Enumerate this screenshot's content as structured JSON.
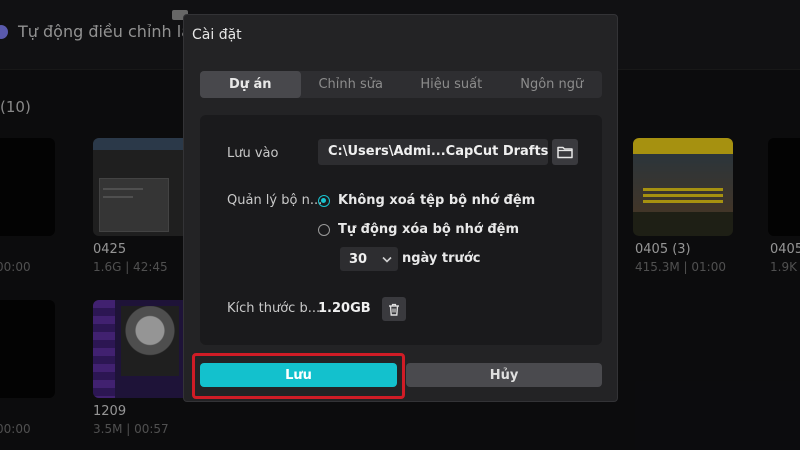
{
  "background": {
    "auto_adjust_label": "Tự động điều chỉnh lại",
    "project_count": "(10)",
    "projects": [
      {
        "title": "",
        "meta": "00:00"
      },
      {
        "title": "0425",
        "meta": "1.6G | 42:45"
      },
      {
        "title": "0405 (3)",
        "meta": "415.3M | 01:00"
      },
      {
        "title": "0405",
        "meta": "1.9K"
      },
      {
        "title": "",
        "meta": "00:00"
      },
      {
        "title": "1209",
        "meta": "3.5M | 00:57"
      }
    ]
  },
  "modal": {
    "title": "Cài đặt",
    "tabs": [
      {
        "label": "Dự án",
        "active": true
      },
      {
        "label": "Chỉnh sửa",
        "active": false
      },
      {
        "label": "Hiệu suất",
        "active": false
      },
      {
        "label": "Ngôn ngữ",
        "active": false
      }
    ],
    "save_location": {
      "label": "Lưu vào",
      "value": "C:\\Users\\Admi...CapCut Drafts",
      "icon": "folder-icon"
    },
    "cache": {
      "label": "Quản lý bộ n...",
      "options": [
        {
          "label": "Không xoá tệp bộ nhớ đệm",
          "selected": true
        },
        {
          "label": "Tự động xóa bộ nhớ đệm",
          "selected": false
        }
      ],
      "days_value": "30",
      "days_suffix": "ngày trước"
    },
    "size": {
      "label": "Kích thước b...",
      "value": "1.20GB",
      "icon": "trash-icon"
    },
    "buttons": {
      "save": "Lưu",
      "cancel": "Hủy"
    }
  },
  "colors": {
    "accent": "#13c1cd",
    "highlight": "#d01c26"
  }
}
